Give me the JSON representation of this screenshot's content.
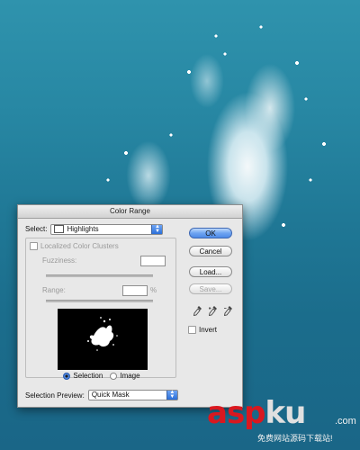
{
  "dialog": {
    "title": "Color Range",
    "select_label": "Select:",
    "select_value": "Highlights",
    "clusters_label": "Localized Color Clusters",
    "fuzziness_label": "Fuzziness:",
    "fuzziness_value": "",
    "range_label": "Range:",
    "range_value": "",
    "range_unit": "%",
    "radio_selection": "Selection",
    "radio_image": "Image",
    "radio_selected": "Selection",
    "preview_label": "Selection Preview:",
    "preview_value": "Quick Mask",
    "buttons": {
      "ok": "OK",
      "cancel": "Cancel",
      "load": "Load...",
      "save": "Save..."
    },
    "invert_label": "Invert",
    "invert_checked": false,
    "clusters_checked": false
  },
  "watermark": {
    "logo_red": "asp",
    "logo_grey": "ku",
    "domain": ".com",
    "subtitle": "免费网站源码下载站!"
  },
  "colors": {
    "default_button": "#4d8ae6",
    "sea": "#1f7795",
    "watermark_red": "#d9181f"
  }
}
